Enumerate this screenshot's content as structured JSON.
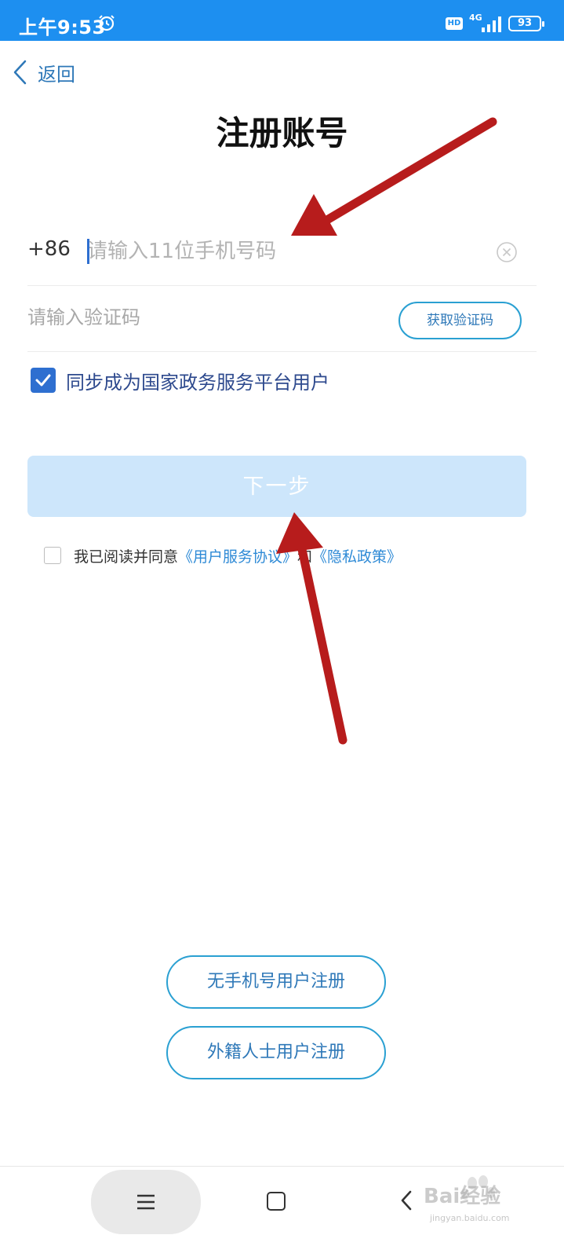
{
  "status_bar": {
    "time": "上午9:53",
    "hd": "HD",
    "network": "4G",
    "battery": "93"
  },
  "header": {
    "back_label": "返回",
    "title": "注册账号"
  },
  "form": {
    "country_code": "+86",
    "phone_placeholder": "请输入11位手机号码",
    "code_placeholder": "请输入验证码",
    "get_code_label": "获取验证码",
    "sync_label": "同步成为国家政务服务平台用户",
    "sync_checked": true,
    "next_label": "下一步"
  },
  "agreement": {
    "checked": false,
    "prefix": "我已阅读并同意",
    "link_terms": "《用户服务协议》",
    "conjunction": "和",
    "link_privacy": "《隐私政策》"
  },
  "alt_register": {
    "no_phone_label": "无手机号用户注册",
    "foreigner_label": "外籍人士用户注册"
  },
  "watermark": {
    "text": "Bai经验",
    "url": "jingyan.baidu.com"
  },
  "colors": {
    "status_bar": "#1d8ff0",
    "accent": "#2e6fd0",
    "link": "#2e8ad6",
    "next_button_disabled": "#cde6fb",
    "annotation_arrow": "#b71c1c"
  }
}
